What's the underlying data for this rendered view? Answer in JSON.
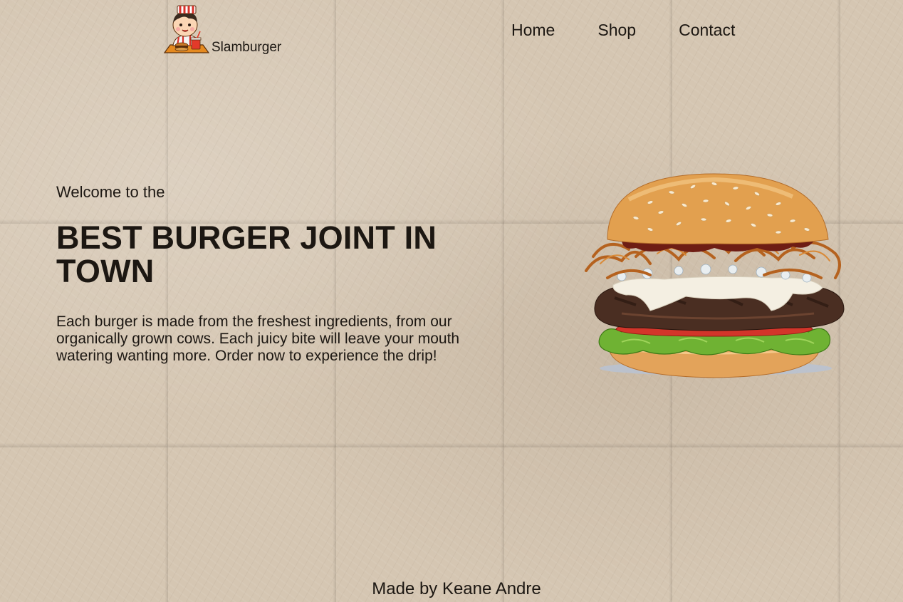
{
  "header": {
    "brand": "Slamburger",
    "logo_icon": "mascot-logo-icon",
    "nav": [
      {
        "label": "Home"
      },
      {
        "label": "Shop"
      },
      {
        "label": "Contact"
      }
    ]
  },
  "hero": {
    "welcome": "Welcome to the",
    "headline": "BEST BURGER JOINT IN TOWN",
    "description": "Each burger is made from the freshest ingredients, from our organically grown cows. Each juicy bite will leave your mouth watering wanting more. Order now to experience the drip!",
    "image_icon": "burger-image"
  },
  "footer": {
    "credit": "Made by Keane Andre"
  },
  "colors": {
    "background": "#d5c6b2",
    "text": "#1c1712"
  }
}
